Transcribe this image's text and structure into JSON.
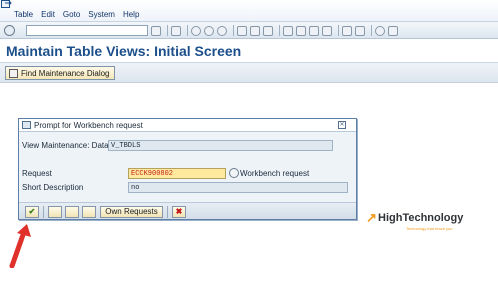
{
  "menubar": {
    "items": [
      "Table",
      "Edit",
      "Goto",
      "System",
      "Help"
    ]
  },
  "toolbar": {
    "command_value": ""
  },
  "title": "Maintain Table Views: Initial Screen",
  "app_toolbar": {
    "find_label": "Find Maintenance Dialog"
  },
  "dialog": {
    "title": "Prompt for Workbench request",
    "view_label": "View Maintenance: Data",
    "view_value": "V_TBDLS",
    "request_label": "Request",
    "request_value": "ECCK900802",
    "request_note": "Workbench request",
    "short_desc_label": "Short Description",
    "short_desc_value": "no",
    "own_requests_label": "Own Requests",
    "ok_glyph": "✔",
    "cancel_glyph": "✖",
    "close_glyph": "✕"
  },
  "logo": {
    "name": "HighTechnology",
    "tagline": "Technology that teach you"
  },
  "colors": {
    "title_blue": "#1d4f8b",
    "accent_orange": "#f29a1b",
    "arrow_red": "#e0302a",
    "required_field_bg": "#ffe99c"
  }
}
